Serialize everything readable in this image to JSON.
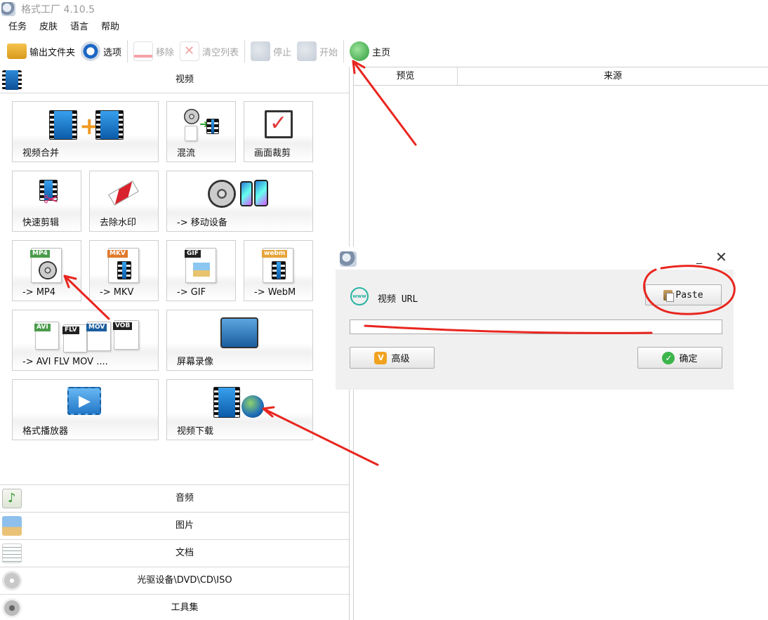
{
  "window": {
    "title": "格式工厂 4.10.5"
  },
  "menu": {
    "items": [
      "任务",
      "皮肤",
      "语言",
      "帮助"
    ]
  },
  "toolbar": {
    "output_folder": "输出文件夹",
    "options": "选项",
    "remove": "移除",
    "clear_list": "清空列表",
    "stop": "停止",
    "start": "开始",
    "home": "主页"
  },
  "categories": {
    "video": "视频",
    "audio": "音频",
    "picture": "图片",
    "document": "文档",
    "disc": "光驱设备\\DVD\\CD\\ISO",
    "tools": "工具集"
  },
  "video_tiles": {
    "merge": "视频合并",
    "mux": "混流",
    "crop": "画面裁剪",
    "quick_clip": "快速剪辑",
    "remove_watermark": "去除水印",
    "mobile": "-> 移动设备",
    "mp4": "-> MP4",
    "mkv": "-> MKV",
    "gif": "-> GIF",
    "webm": "-> WebM",
    "avi_flv_mov": "-> AVI FLV MOV ....",
    "screen_record": "屏幕录像",
    "player": "格式播放器",
    "video_download": "视频下载"
  },
  "tile_tags": {
    "mp4": "MP4",
    "mkv": "MKV",
    "gif": "GIF",
    "webm": "webm",
    "avi": "AVI",
    "flv": "FLV",
    "mov": "MOV",
    "vob": "VOB"
  },
  "task_list": {
    "columns": [
      "预览",
      "来源"
    ]
  },
  "dialog": {
    "label": "视频 URL",
    "paste": "Paste",
    "url_value": "",
    "advanced": "高级",
    "ok": "确定",
    "www": "www"
  },
  "colors": {
    "annotation_red": "#e8261f"
  }
}
